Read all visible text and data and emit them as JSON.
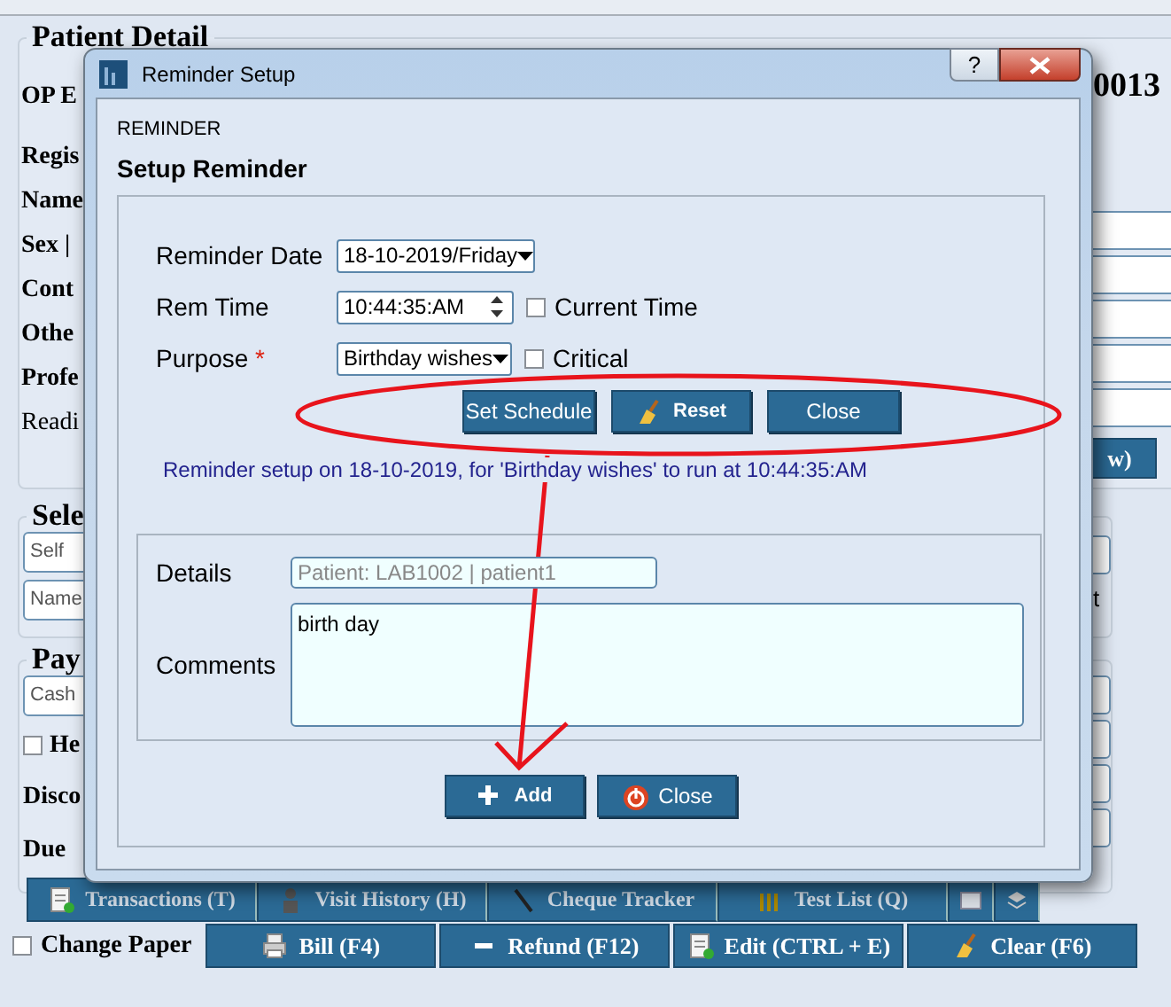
{
  "background": {
    "patient_detail": {
      "legend": "Patient Detail",
      "labels": [
        {
          "text": "OP E",
          "bold": true
        },
        {
          "text": "Regis",
          "bold": true
        },
        {
          "text": "Name",
          "bold": true
        },
        {
          "text": "Sex |",
          "bold": true
        },
        {
          "text": "Cont",
          "bold": true
        },
        {
          "text": "Othe",
          "bold": true
        },
        {
          "text": "Profe",
          "bold": true
        },
        {
          "text": "Readi",
          "bold": false
        }
      ],
      "op_number": "0013",
      "button": "w)"
    },
    "select_section": {
      "legend": "Sele",
      "fields": [
        "Self",
        "Name"
      ],
      "side_text": "t"
    },
    "payment_section": {
      "legend": "Pay",
      "mode": "Cash",
      "checkbox": {
        "label": "He",
        "checked": false
      },
      "labels": [
        "Disco",
        "Due"
      ]
    },
    "tabs": [
      {
        "label": "Transactions (T)"
      },
      {
        "label": "Visit History (H)"
      },
      {
        "label": "Cheque Tracker"
      },
      {
        "label": "Test List (Q)"
      }
    ],
    "change_paper": {
      "label": "Change Paper",
      "checked": false
    },
    "buttons": [
      {
        "label": "Bill (F4)"
      },
      {
        "label": "Refund (F12)"
      },
      {
        "label": "Edit (CTRL + E)"
      },
      {
        "label": "Clear (F6)"
      }
    ]
  },
  "dialog": {
    "title": "Reminder Setup",
    "help": "?",
    "section": "REMINDER",
    "heading": "Setup Reminder",
    "reminder_date": {
      "label": "Reminder Date",
      "value": "18-10-2019/Friday"
    },
    "rem_time": {
      "label": "Rem Time",
      "value": "10:44:35:AM",
      "option": {
        "label": "Current Time",
        "checked": false
      }
    },
    "purpose": {
      "label": "Purpose",
      "required_mark": "*",
      "value": "Birthday wishes",
      "option": {
        "label": "Critical",
        "checked": false
      }
    },
    "buttons": [
      {
        "label": "Set Schedule"
      },
      {
        "label": "Reset"
      },
      {
        "label": "Close"
      }
    ],
    "message": "Reminder setup on 18-10-2019, for  'Birthday wishes' to run at 10:44:35:AM",
    "details": {
      "label": "Details",
      "placeholder": "Patient: LAB1002 | patient1"
    },
    "comments": {
      "label": "Comments",
      "value": "birth day"
    },
    "footer_buttons": [
      {
        "label": "Add"
      },
      {
        "label": "Close"
      }
    ]
  }
}
